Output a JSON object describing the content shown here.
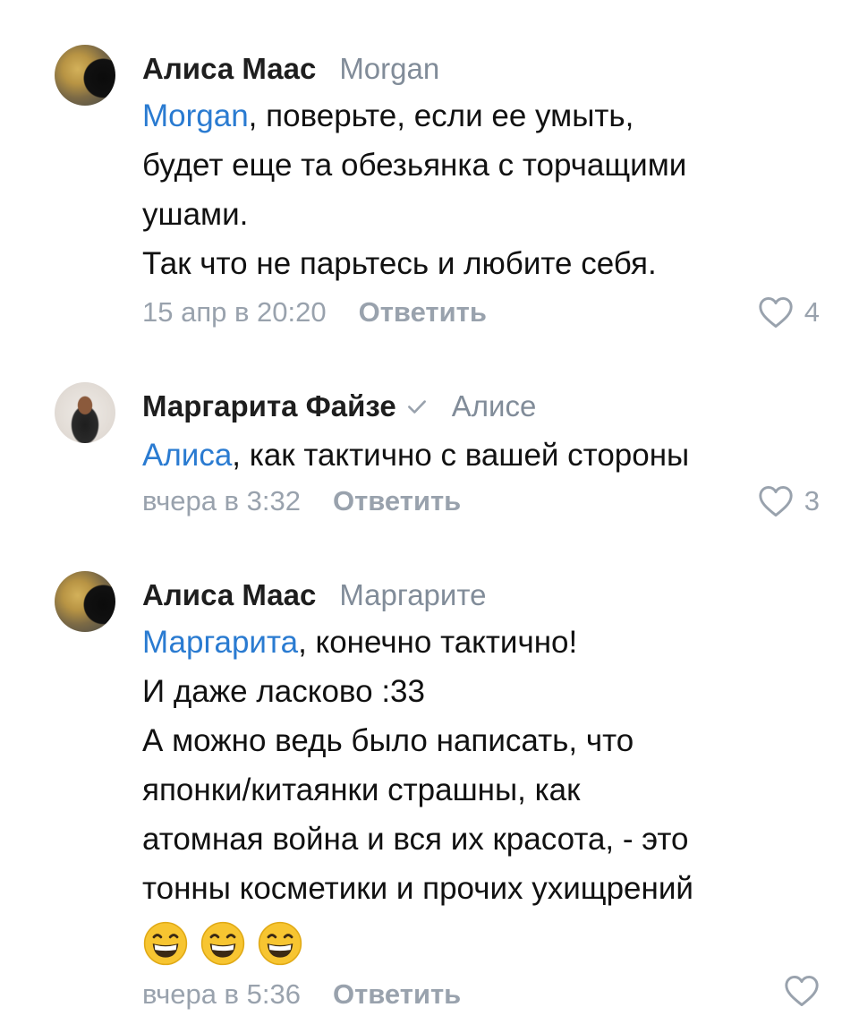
{
  "comments": [
    {
      "author": "Алиса Маас",
      "reply_to": "Morgan",
      "mention": "Morgan",
      "lines": [
        ", поверьте, если ее умыть,",
        "будет еще та обезьянка с торчащими",
        "ушами.",
        "Так что не парьтесь и любите себя."
      ],
      "date": "15 апр в 20:20",
      "reply_label": "Ответить",
      "likes": "4"
    },
    {
      "author": "Маргарита Файзе",
      "verified": true,
      "reply_to": "Алисе",
      "mention": "Алиса",
      "lines": [
        ", как тактично с вашей стороны"
      ],
      "date": "вчера в 3:32",
      "reply_label": "Ответить",
      "likes": "3"
    },
    {
      "author": "Алиса Маас",
      "reply_to": "Маргарите",
      "mention": "Маргарита",
      "lines": [
        ", конечно тактично!",
        "И даже ласково :33",
        "А можно ведь было написать, что",
        "японки/китаянки страшны, как",
        "атомная война и вся их красота, - это",
        "тонны косметики и прочих ухищрений"
      ],
      "emoji": [
        "grinning-face",
        "grinning-face",
        "grinning-face"
      ],
      "date": "вчера в 5:36",
      "reply_label": "Ответить",
      "likes": ""
    }
  ],
  "colors": {
    "mention": "#2a7bd1",
    "secondary": "#818c99",
    "meta": "#99a2ad"
  },
  "icons": {
    "like": "heart-outline-icon",
    "verified": "checkmark-icon",
    "emoji": "grinning-face-icon"
  }
}
